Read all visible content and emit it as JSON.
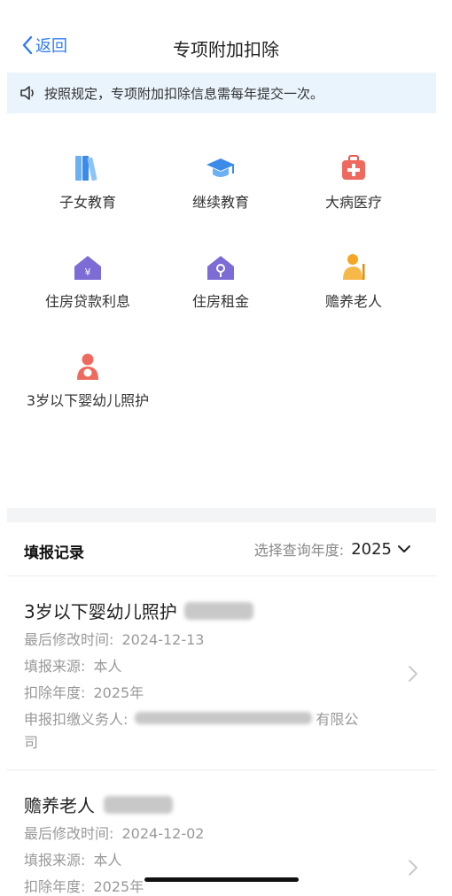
{
  "nav": {
    "back_label": "返回",
    "title": "专项附加扣除"
  },
  "notice": {
    "text": "按照规定，专项附加扣除信息需每年提交一次。"
  },
  "categories": [
    {
      "label": "子女教育",
      "icon": "books-icon"
    },
    {
      "label": "继续教育",
      "icon": "graduation-cap-icon"
    },
    {
      "label": "大病医疗",
      "icon": "medical-kit-icon"
    },
    {
      "label": "住房贷款利息",
      "icon": "house-yuan-icon"
    },
    {
      "label": "住房租金",
      "icon": "house-key-icon"
    },
    {
      "label": "赡养老人",
      "icon": "elderly-person-icon"
    },
    {
      "label": "3岁以下婴幼儿照护",
      "icon": "mother-baby-icon"
    }
  ],
  "records": {
    "title": "填报记录",
    "year_prompt": "选择查询年度:",
    "year_value": "2025",
    "items": [
      {
        "name": "3岁以下婴幼儿照护",
        "modified_label": "最后修改时间:",
        "modified_value": "2024-12-13",
        "source_label": "填报来源:",
        "source_value": "本人",
        "year_label": "扣除年度:",
        "year_value": "2025年",
        "payer_label": "申报扣缴义务人:",
        "payer_suffix": "有限公",
        "payer_wrap": "司"
      },
      {
        "name": "赡养老人",
        "modified_label": "最后修改时间:",
        "modified_value": "2024-12-02",
        "source_label": "填报来源:",
        "source_value": "本人",
        "year_label": "扣除年度:",
        "year_value": "2025年"
      }
    ]
  },
  "colors": {
    "accent": "#2f7bf5",
    "notice_bg": "#eaf4fd"
  }
}
